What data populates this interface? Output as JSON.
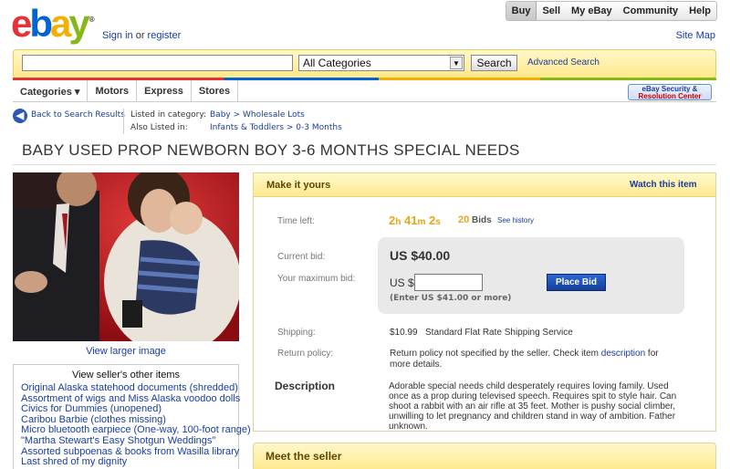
{
  "logo": {
    "l1": "e",
    "l2": "b",
    "l3": "a",
    "l4": "y",
    "reg": "®"
  },
  "header": {
    "signin": "Sign in",
    "or": "or",
    "register": "register",
    "sitemap": "Site Map"
  },
  "topnav": [
    "Buy",
    "Sell",
    "My eBay",
    "Community",
    "Help"
  ],
  "search": {
    "category": "All Categories",
    "button": "Search",
    "advanced": "Advanced Search"
  },
  "catnav": [
    "Categories ▾",
    "Motors",
    "Express",
    "Stores"
  ],
  "security": {
    "line1": "eBay Security &",
    "line2": "Resolution Center"
  },
  "breadcrumb": {
    "back": "Back to Search Results",
    "listed_label": "Listed in category:",
    "also_label": "Also Listed in:",
    "listed_cat": "Baby > Wholesale Lots",
    "also_cat": "Infants & Toddlers > 0-3 Months"
  },
  "item": {
    "title": "BABY USED  PROP  NEWBORN BOY  3-6 MONTHS  SPECIAL NEEDS"
  },
  "photo": {
    "larger": "View larger image"
  },
  "seller_items": {
    "heading": "View seller's other items",
    "items": [
      "Original Alaska statehood documents (shredded)",
      "Assortment of wigs and Miss Alaska voodoo dolls",
      "Civics for Dummies (unopened)",
      "Caribou Barbie (clothes missing)",
      "Micro bluetooth earpiece (One-way, 100-foot range)",
      "\"Martha Stewart's Easy Shotgun Weddings\"",
      "Assorted subpoenas & books from Wasilla library",
      "Last shred of my dignity"
    ]
  },
  "bid": {
    "header": "Make it yours",
    "watch": "Watch this item",
    "time_label": "Time left:",
    "t_h": "2",
    "t_hu": "h",
    "t_m": "41",
    "t_mu": "m",
    "t_s": "2",
    "t_su": "s",
    "bids_n": "20",
    "bids_label": "Bids",
    "see_history": "See history",
    "current_label": "Current bid:",
    "current": "US $40.00",
    "max_label": "Your maximum bid:",
    "usd": "US $",
    "enter": "(Enter US $41.00 or more)",
    "place": "Place Bid",
    "ship_label": "Shipping:",
    "ship_cost": "$10.99",
    "ship_service": "Standard Flat Rate Shipping Service",
    "return_label": "Return policy:",
    "return_text": "Return policy not specified by the seller. Check item",
    "return_link": "description",
    "return_tail": "for",
    "return_tail2": "more details.",
    "desc_label": "Description",
    "description": "Adorable special needs child desperately requires loving family. Used once as a prop during televised speech. Requires spit to style hair. Can shoot a rabbit with an air rifle at 35 feet. Mother is pushy social climber, unwilling to let pregnancy and children stand in way of ambition. Father unknown."
  },
  "meet": "Meet the seller"
}
